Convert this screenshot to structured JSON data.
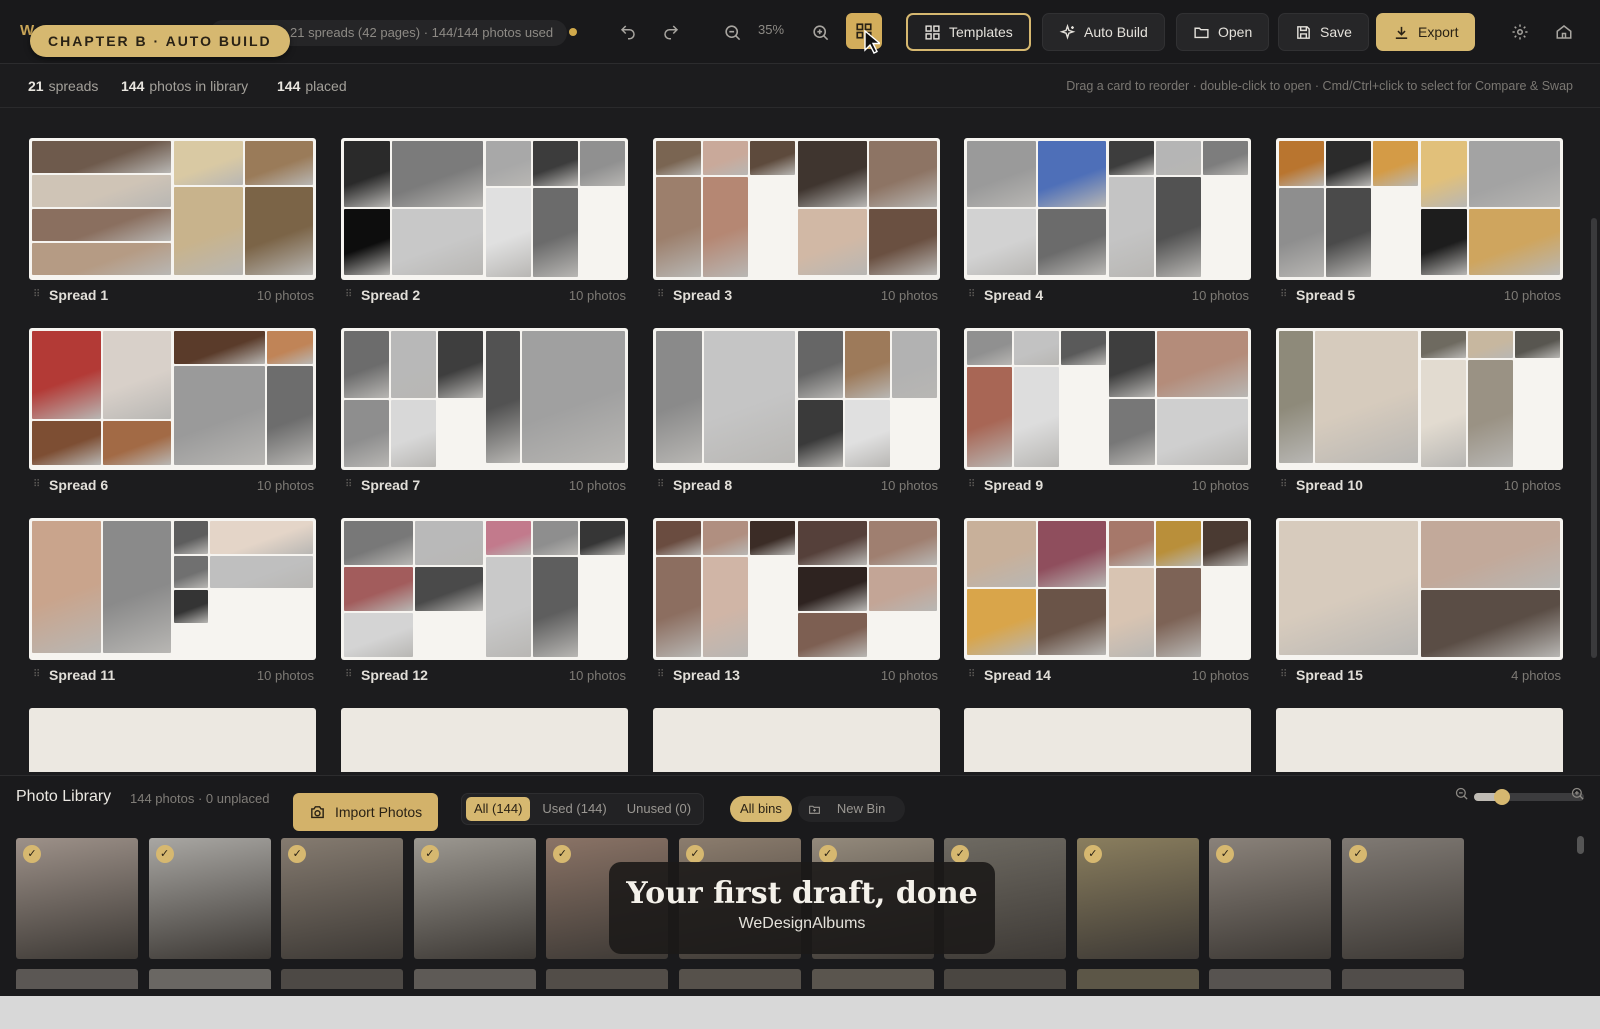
{
  "toolbar": {
    "logo": "W",
    "status": "21 spreads (42 pages) · 144/144 photos used",
    "chapter_pill": "CHAPTER B · AUTO BUILD",
    "zoom": "35%",
    "buttons": {
      "templates": "Templates",
      "auto_build": "Auto Build",
      "open": "Open",
      "save": "Save",
      "export": "Export"
    }
  },
  "subbar": {
    "spreads_count": "21",
    "spreads_label": "spreads",
    "library_count": "144",
    "library_label": "photos in library",
    "placed_count": "144",
    "placed_label": "placed",
    "hint": "Drag a card to reorder · double-click to open · Cmd/Ctrl+click to select for Compare & Swap"
  },
  "spreads": [
    {
      "label": "Spread 1",
      "count": "10 photos",
      "palette": [
        "#6e5a4c",
        "#cfc4b6",
        "#8a6f5f",
        "#b59b84",
        "#4a3b33",
        "#d9c9a3",
        "#9a7b59",
        "#c8b38c",
        "#7b6447",
        "#e0d2b8"
      ]
    },
    {
      "label": "Spread 2",
      "count": "10 photos",
      "palette": [
        "#2a2a2a",
        "#7b7b7b",
        "#0d0d0d",
        "#c8c8c8",
        "#5a5a5a",
        "#a8a8a8",
        "#3c3c3c",
        "#909090",
        "#e0e0e0",
        "#6b6b6b"
      ]
    },
    {
      "label": "Spread 3",
      "count": "10 photos",
      "palette": [
        "#7a6552",
        "#c9a99a",
        "#5d4a3c",
        "#9c7f6c",
        "#b58773",
        "#3f352f",
        "#8d7464",
        "#d1b8a5",
        "#6a5041",
        "#a98f7f"
      ]
    },
    {
      "label": "Spread 4",
      "count": "10 photos",
      "palette": [
        "#9a9a9a",
        "#4e6fb8",
        "#d2d2d2",
        "#6b6b6b",
        "#8aa0d6",
        "#3d3d3d",
        "#b5b5b5",
        "#7d7d7d",
        "#c4c4c4",
        "#525252"
      ]
    },
    {
      "label": "Spread 5",
      "count": "10 photos",
      "palette": [
        "#b9752f",
        "#2b2b2b",
        "#d49b46",
        "#8e8e8e",
        "#4a4a4a",
        "#e1c07a",
        "#a3a3a3",
        "#1d1d1d",
        "#cfa55e",
        "#6e6e6e"
      ]
    },
    {
      "label": "Spread 6",
      "count": "10 photos",
      "palette": [
        "#b33a36",
        "#d8d0c9",
        "#7d4e33",
        "#a26a45",
        "#eae5df",
        "#5a3b2a",
        "#c08457",
        "#9a9a9a",
        "#6d6d6d",
        "#c9c2bb"
      ]
    },
    {
      "label": "Spread 7",
      "count": "10 photos",
      "palette": [
        "#6c6c6c",
        "#b8b8b8",
        "#3e3e3e",
        "#8e8e8e",
        "#d8d8d8",
        "#525252",
        "#a0a0a0",
        "#2d2d2d",
        "#c6c6c6",
        "#7a7a7a"
      ]
    },
    {
      "label": "Spread 8",
      "count": "10 photos",
      "palette": [
        "#8a8a8a",
        "#c5c5c5",
        "#464646",
        "#a1865e",
        "#d3d3d3",
        "#666666",
        "#9d7a5a",
        "#b2b2b2",
        "#3a3a3a",
        "#e0e0e0"
      ]
    },
    {
      "label": "Spread 9",
      "count": "10 photos",
      "palette": [
        "#909090",
        "#c2c2c2",
        "#5a5a5a",
        "#a86655",
        "#dddddd",
        "#3e3e3e",
        "#b48c7a",
        "#777777",
        "#cfcfcf",
        "#2e2e2e"
      ]
    },
    {
      "label": "Spread 10",
      "count": "10 photos",
      "palette": [
        "#8e8a7a",
        "#d6cbbd",
        "#3c3b38",
        "#b0a596",
        "#efe8df",
        "#6e6a60",
        "#c7b79f",
        "#585650",
        "#e2dbd0",
        "#9a9284"
      ]
    },
    {
      "label": "Spread 11",
      "count": "10 photos",
      "palette": [
        "#c9a48c",
        "#8a8a8a",
        "#4a3428",
        "#d7d7d7",
        "#a6a6a6",
        "#5d5d5d",
        "#e4d5c8",
        "#707070",
        "#bfbfbf",
        "#343434"
      ]
    },
    {
      "label": "Spread 12",
      "count": "10 photos",
      "palette": [
        "#787878",
        "#b9b9b9",
        "#a25c5c",
        "#4a4a4a",
        "#d4d4d4",
        "#c27a8c",
        "#8e8e8e",
        "#363636",
        "#c9c9c9",
        "#5e5e5e"
      ]
    },
    {
      "label": "Spread 13",
      "count": "10 photos",
      "palette": [
        "#6a4c40",
        "#b08f80",
        "#3b2c26",
        "#8c6e60",
        "#d0b5a6",
        "#55403a",
        "#9f7f70",
        "#2e2320",
        "#c3a596",
        "#7d5f52"
      ]
    },
    {
      "label": "Spread 14",
      "count": "10 photos",
      "palette": [
        "#c8b09a",
        "#8f4e5d",
        "#d9a54a",
        "#6a5448",
        "#e8ddd0",
        "#a6786a",
        "#b98f3a",
        "#4a3a32",
        "#d8c4b2",
        "#7d6356"
      ]
    },
    {
      "label": "Spread 15",
      "count": "4 photos",
      "palette": [
        "#d7cbbd",
        "#8d7e74",
        "#c2a99a",
        "#5a4d45"
      ]
    }
  ],
  "empty_cards": 5,
  "library": {
    "title": "Photo Library",
    "subtitle": "144 photos · 0 unplaced",
    "import_label": "Import Photos",
    "filters": [
      "All (144)",
      "Used (144)",
      "Unused (0)"
    ],
    "active_filter": "All (144)",
    "bins_active": "All bins",
    "new_bin": "New Bin",
    "zoom_level": 0.25,
    "photo_colors": [
      "#9d9189",
      "#a9a7a3",
      "#857b70",
      "#9c9891",
      "#8a7366",
      "#8c7d6e",
      "#948a7c",
      "#6e6a62",
      "#8a7e5e",
      "#8a827a",
      "#807a74"
    ],
    "row2_colors": [
      "#5b5754",
      "#6a6763",
      "#4d4945",
      "#5e5a56",
      "#524d48",
      "#56514b",
      "#5a554e",
      "#4a4641",
      "#5c5647",
      "#575350",
      "#514d4a"
    ]
  },
  "banner": {
    "title": "Your first draft, done",
    "subtitle": "WeDesignAlbums"
  },
  "colors": {
    "accent": "#d6b870",
    "background": "#1c1c1e",
    "card": "#f6f4f0"
  }
}
